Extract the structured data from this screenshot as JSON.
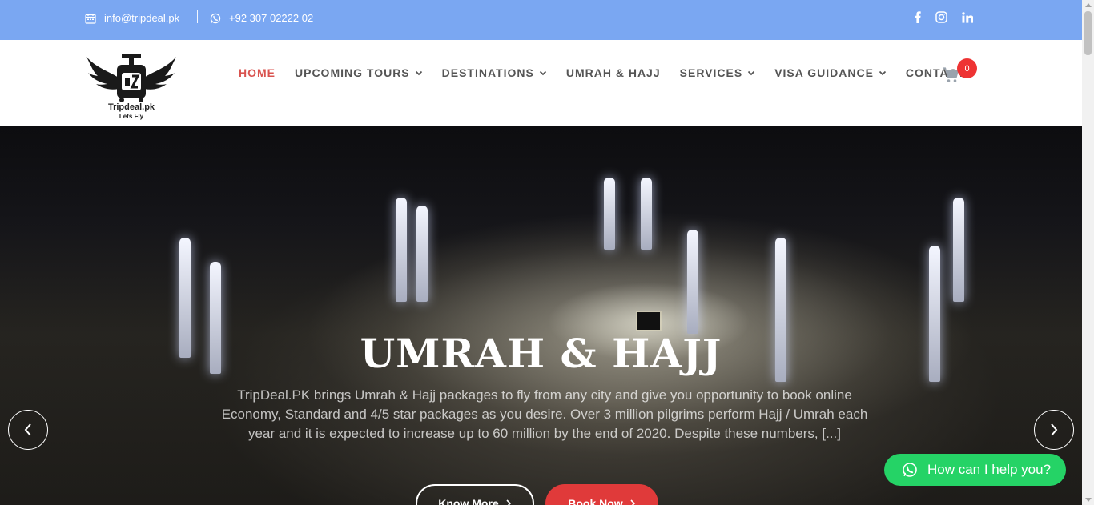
{
  "topbar": {
    "email": "info@tripdeal.pk",
    "email_icon": "calendar-icon",
    "phone": "+92 307 02222 02",
    "phone_icon": "whatsapp-icon",
    "social": [
      "facebook-icon",
      "instagram-icon",
      "linkedin-icon"
    ],
    "background": "#7aa7f2"
  },
  "logo": {
    "brand": "Tripdeal.pk",
    "tagline": "Lets Fly"
  },
  "nav": {
    "items": [
      {
        "label": "HOME",
        "active": true
      },
      {
        "label": "UPCOMING TOURS",
        "dropdown": true
      },
      {
        "label": "DESTINATIONS",
        "dropdown": true
      },
      {
        "label": "UMRAH & HAJJ"
      },
      {
        "label": "SERVICES",
        "dropdown": true
      },
      {
        "label": "VISA GUIDANCE",
        "dropdown": true
      },
      {
        "label": "CONTACT"
      }
    ],
    "active_color": "#d9534f"
  },
  "cart": {
    "count": "0",
    "icon": "cart-icon",
    "badge_color": "#e33333"
  },
  "hero": {
    "title": "UMRAH & HAJJ",
    "description": "TripDeal.PK brings Umrah & Hajj packages to fly from any city and give you opportunity to book online Economy, Standard and 4/5 star packages as you desire. Over 3 million pilgrims perform Hajj / Umrah each year and it is expected to increase up to 60 million by the end of 2020. Despite these numbers, [...]",
    "button_more": "Know More",
    "button_book": "Book Now",
    "book_color": "#e03a3a"
  },
  "chat": {
    "label": "How can I help you?",
    "icon": "whatsapp-icon",
    "color": "#25d366"
  }
}
